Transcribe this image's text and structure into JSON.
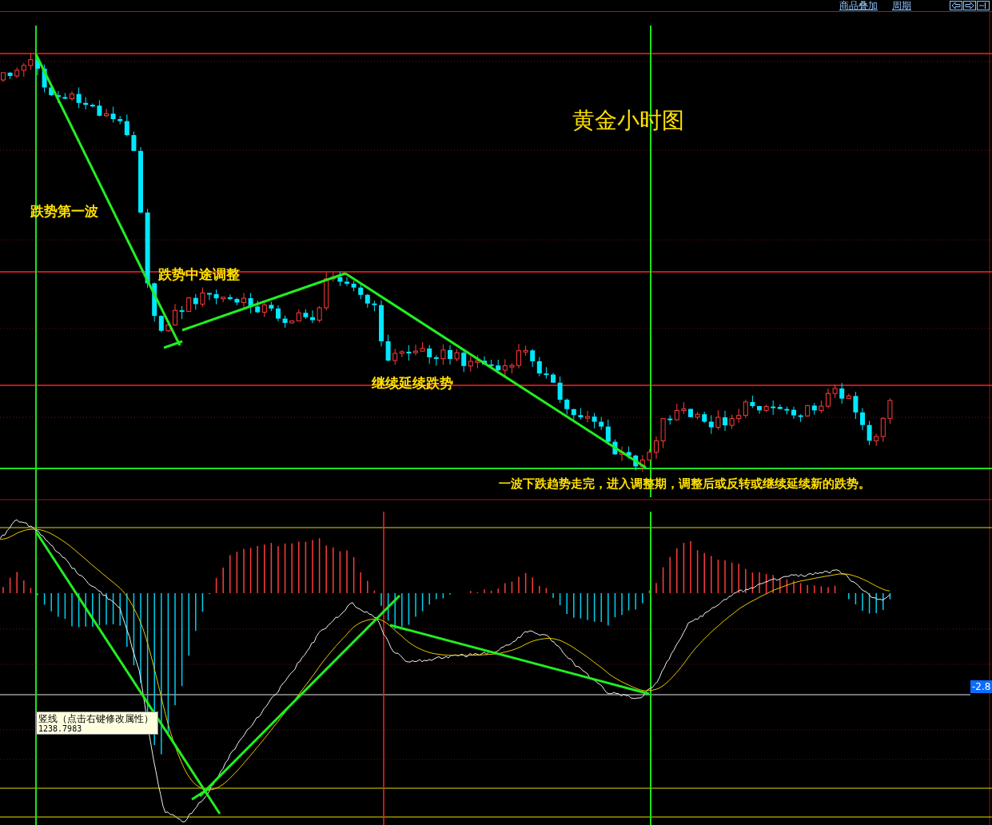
{
  "top_bar": {
    "links": [
      "商品叠加",
      "周期"
    ]
  },
  "chart": {
    "title": "黄金小时图",
    "annotations": [
      "跌势第一波",
      "跌势中途调整",
      "继续延续跌势"
    ],
    "note": "一波下跌趋势走完，进入调整期，调整后或反转或继续延续新的跌势。",
    "tooltip": {
      "title": "竖线（点击右键修改属性）",
      "value": "1238.7983"
    }
  },
  "macd": {
    "current_value": "-2.8"
  }
}
